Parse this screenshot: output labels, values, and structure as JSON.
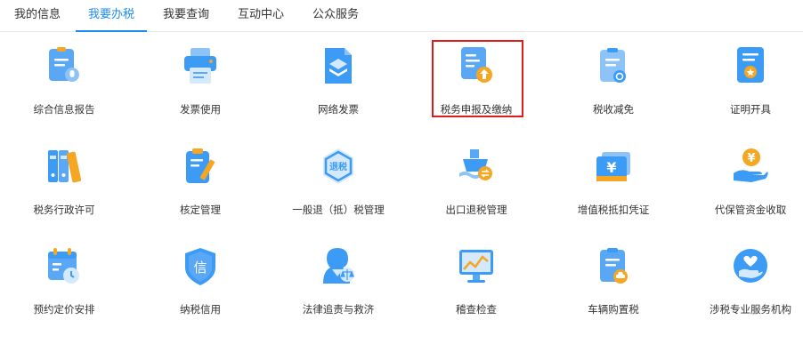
{
  "tabs": [
    {
      "label": "我的信息"
    },
    {
      "label": "我要办税",
      "active": true
    },
    {
      "label": "我要查询"
    },
    {
      "label": "互动中心"
    },
    {
      "label": "公众服务"
    }
  ],
  "services": [
    {
      "label": "综合信息报告",
      "icon": "info-report-icon"
    },
    {
      "label": "发票使用",
      "icon": "printer-icon"
    },
    {
      "label": "网络发票",
      "icon": "e-invoice-icon"
    },
    {
      "label": "税务申报及缴纳",
      "icon": "declare-pay-icon",
      "highlighted": true
    },
    {
      "label": "税收减免",
      "icon": "tax-relief-icon"
    },
    {
      "label": "证明开具",
      "icon": "certificate-icon"
    },
    {
      "label": "税务行政许可",
      "icon": "binders-icon"
    },
    {
      "label": "核定管理",
      "icon": "clipboard-edit-icon"
    },
    {
      "label": "一般退（抵）税管理",
      "icon": "tax-refund-icon",
      "icon_text": "退税"
    },
    {
      "label": "出口退税管理",
      "icon": "export-ship-icon"
    },
    {
      "label": "增值税抵扣凭证",
      "icon": "vat-voucher-icon",
      "icon_text": "¥"
    },
    {
      "label": "代保管资金收取",
      "icon": "money-hand-icon",
      "icon_text": "¥"
    },
    {
      "label": "预约定价安排",
      "icon": "calendar-clock-icon"
    },
    {
      "label": "纳税信用",
      "icon": "credit-shield-icon",
      "icon_text": "信"
    },
    {
      "label": "法律追责与救济",
      "icon": "lawyer-scale-icon"
    },
    {
      "label": "稽查检查",
      "icon": "monitor-chart-icon"
    },
    {
      "label": "车辆购置税",
      "icon": "vehicle-tax-icon"
    },
    {
      "label": "涉税专业服务机构",
      "icon": "heart-hand-icon"
    }
  ],
  "colors": {
    "accent": "#1b8cf0",
    "icon_blue": "#3b9bf5",
    "icon_orange": "#f5a623",
    "highlight": "#e31b1b"
  }
}
